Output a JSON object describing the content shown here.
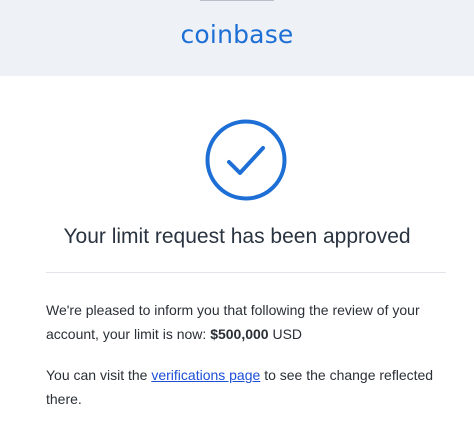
{
  "brand": {
    "logo_text": "coinbase",
    "brand_color": "#1d6fd6"
  },
  "status_icon": "check-circle-icon",
  "headline": "Your limit request has been approved",
  "body": {
    "p1_text": "We're pleased to inform you that following the review of your account, your limit is now:",
    "p1_amount": "$500,000",
    "p1_currency": "USD",
    "p2_before": "You can visit the",
    "p2_link": "verifications page",
    "p2_after": "to see the change reflected there."
  },
  "colors": {
    "header_bg": "#eef1f5",
    "link": "#1d4fd6"
  }
}
